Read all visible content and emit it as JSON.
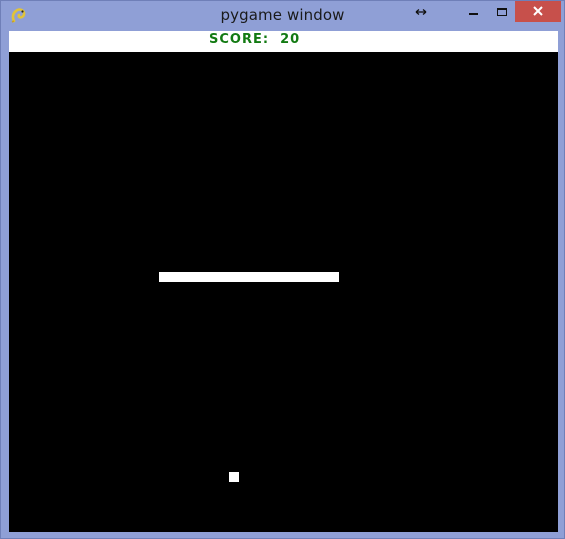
{
  "window": {
    "title": "pygame window",
    "app_icon": "pygame-snake-icon",
    "resize_icon": "horizontal-resize-arrow-icon",
    "controls": {
      "minimize_icon": "minimize-icon",
      "maximize_icon": "maximize-icon",
      "close_icon": "close-icon"
    },
    "frame_color": "#8f9fd6",
    "close_color": "#c7504b"
  },
  "game": {
    "score_label": "SCORE:",
    "score_value": "20",
    "score_color": "#127a12",
    "background_color": "#000000",
    "paddle_color": "#ffffff",
    "ball_color": "#ffffff"
  }
}
